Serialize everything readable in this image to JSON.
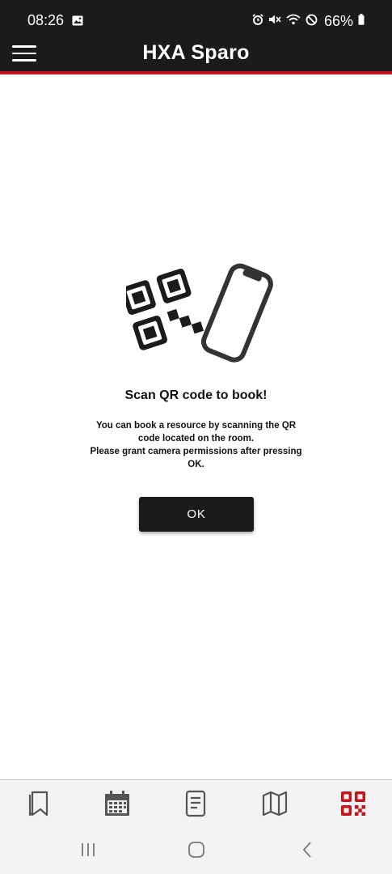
{
  "status_bar": {
    "time": "08:26",
    "battery": "66%",
    "icons": [
      "image-icon",
      "alarm-icon",
      "mute-icon",
      "wifi-icon",
      "do-not-disturb-icon",
      "battery-icon"
    ]
  },
  "app_bar": {
    "title": "HXA Sparo",
    "accent_color": "#c4151c",
    "background": "#1d1a1b"
  },
  "content": {
    "illustration": "qr-phone-illustration",
    "heading": "Scan QR code to book!",
    "description_lines": [
      "You can book a resource by scanning the QR",
      "code located on the room.",
      "Please grant camera permissions after pressing",
      "OK."
    ],
    "ok_label": "OK"
  },
  "bottom_nav": {
    "items": [
      {
        "icon": "bookmark-icon",
        "active": false
      },
      {
        "icon": "calendar-icon",
        "active": false
      },
      {
        "icon": "document-icon",
        "active": false
      },
      {
        "icon": "map-icon",
        "active": false
      },
      {
        "icon": "qr-code-icon",
        "active": true
      }
    ],
    "active_color": "#c4151c",
    "inactive_color": "#555555"
  },
  "system_nav": [
    "recent-apps",
    "home",
    "back"
  ]
}
